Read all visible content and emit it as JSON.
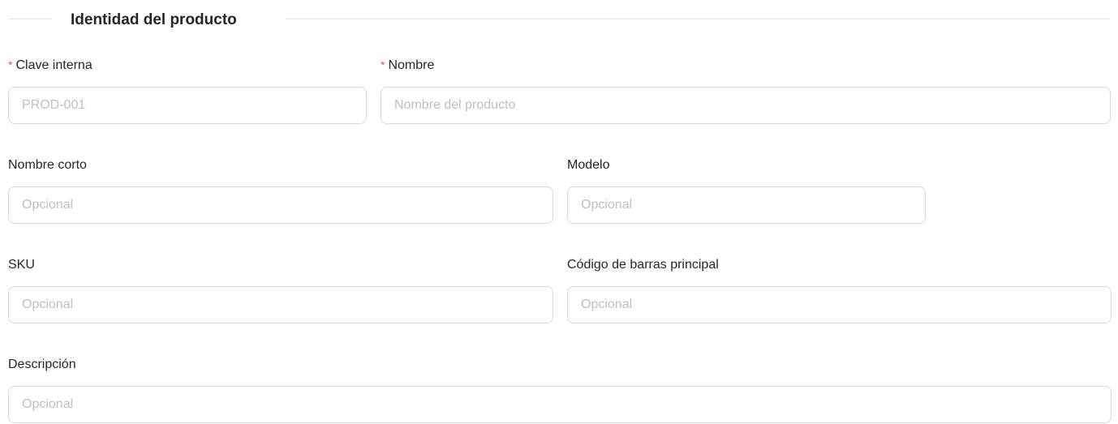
{
  "section": {
    "title": "Identidad del producto"
  },
  "fields": {
    "clave_interna": {
      "label": "Clave interna",
      "required_mark": "*",
      "placeholder": "PROD-001",
      "value": ""
    },
    "nombre": {
      "label": "Nombre",
      "required_mark": "*",
      "placeholder": "Nombre del producto",
      "value": ""
    },
    "nombre_corto": {
      "label": "Nombre corto",
      "placeholder": "Opcional",
      "value": ""
    },
    "modelo": {
      "label": "Modelo",
      "placeholder": "Opcional",
      "value": ""
    },
    "sku": {
      "label": "SKU",
      "placeholder": "Opcional",
      "value": ""
    },
    "codigo_barras": {
      "label": "Código de barras principal",
      "placeholder": "Opcional",
      "value": ""
    },
    "descripcion": {
      "label": "Descripción",
      "placeholder": "Opcional",
      "value": ""
    }
  },
  "colors": {
    "required": "#ff4d4f",
    "border": "#d9d9d9",
    "placeholder": "#bfbfbf"
  }
}
